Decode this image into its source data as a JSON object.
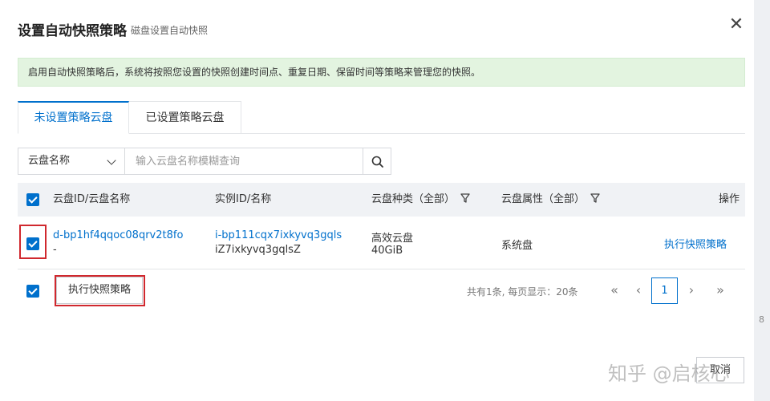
{
  "dialog": {
    "title": "设置自动快照策略",
    "subtitle": "磁盘设置自动快照",
    "close_label": "✕"
  },
  "notice": "启用自动快照策略后，系统将按照您设置的快照创建时间点、重复日期、保留时间等策略来管理您的快照。",
  "tabs": [
    {
      "label": "未设置策略云盘",
      "active": true
    },
    {
      "label": "已设置策略云盘",
      "active": false
    }
  ],
  "filter": {
    "select_value": "云盘名称",
    "search_placeholder": "输入云盘名称模糊查询"
  },
  "table": {
    "columns": [
      "云盘ID/云盘名称",
      "实例ID/名称",
      "云盘种类（全部）",
      "云盘属性（全部）",
      "操作"
    ],
    "rows": [
      {
        "disk_id": "d-bp1hf4qqoc08qrv2t8fo",
        "disk_name": "-",
        "instance_id": "i-bp111cqx7ixkyvq3gqls",
        "instance_name": "iZ7ixkyvq3gqlsZ",
        "disk_type": "高效云盘",
        "disk_size": "40GiB",
        "disk_attr": "系统盘",
        "action": "执行快照策略"
      }
    ]
  },
  "footer": {
    "exec_button": "执行快照策略",
    "total_text": "共有1条, 每页显示：20条",
    "first": "«",
    "prev": "‹",
    "page": "1",
    "next": "›",
    "last": "»"
  },
  "cancel_button": "取消",
  "watermark": "知乎 @启核心",
  "colors": {
    "accent": "#0070cc",
    "notice_bg": "#e3f4e0",
    "highlight_box": "#d0282e",
    "header_bg": "#f0f2f5"
  }
}
